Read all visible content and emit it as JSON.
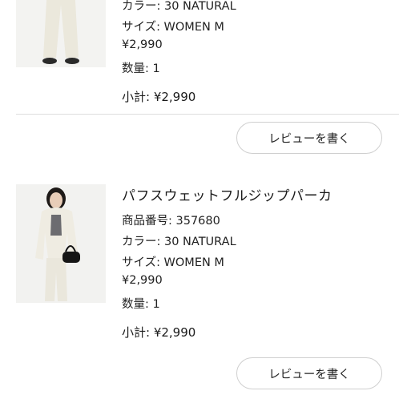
{
  "items": [
    {
      "title": "",
      "product_number": "",
      "color": "カラー: 30 NATURAL",
      "size": "サイズ: WOMEN M",
      "price": "¥2,990",
      "quantity": "数量: 1",
      "subtotal": "小計: ¥2,990",
      "review_label": "レビューを書く"
    },
    {
      "title": "パフスウェットフルジップパーカ",
      "product_number": "商品番号: 357680",
      "color": "カラー: 30 NATURAL",
      "size": "サイズ: WOMEN M",
      "price": "¥2,990",
      "quantity": "数量: 1",
      "subtotal": "小計: ¥2,990",
      "review_label": "レビューを書く"
    }
  ],
  "colors": {
    "text": "#1a1a1a",
    "divider": "#dddddd",
    "button_border": "#cfcfcf",
    "garment": "#efece2"
  }
}
